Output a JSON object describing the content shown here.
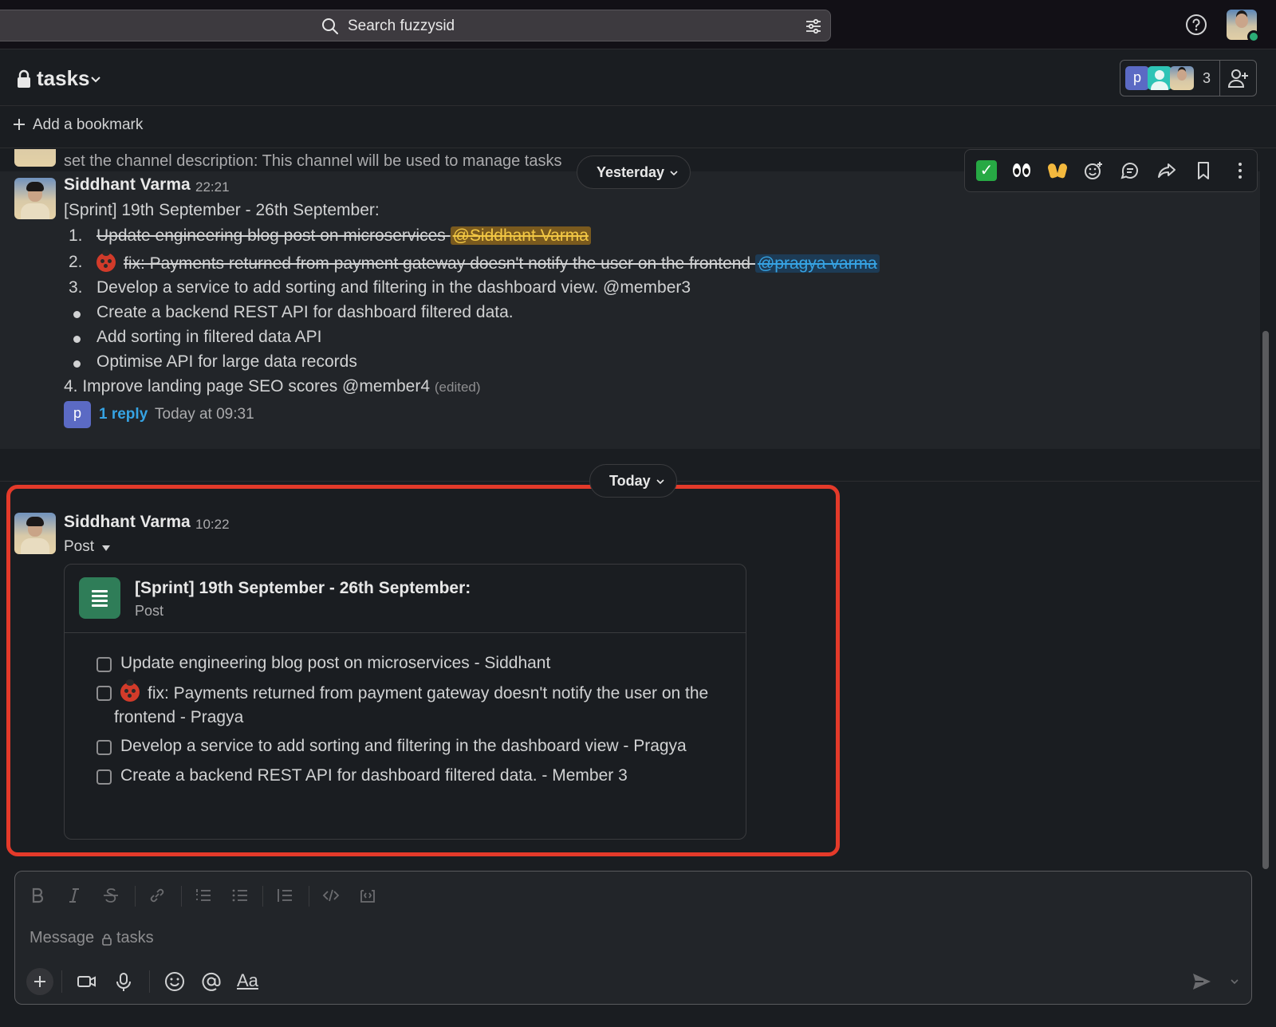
{
  "search": {
    "placeholder": "Search fuzzysid"
  },
  "channel": {
    "name": "tasks",
    "member_count": "3",
    "member_initial": "p"
  },
  "bookmarks": {
    "add_label": "Add a bookmark"
  },
  "previous_message": {
    "text": "set the channel description: This channel will be used to manage tasks"
  },
  "date_dividers": {
    "yesterday": "Yesterday",
    "today": "Today"
  },
  "sprint_message": {
    "author": "Siddhant Varma",
    "time": "22:21",
    "title": "[Sprint] 19th September - 26th September:",
    "items": [
      {
        "num": "1.",
        "text": "Update engineering blog post on microservices ",
        "mention": "@Siddhant Varma"
      },
      {
        "num": "2.",
        "text": "fix: Payments returned from payment gateway doesn't notify the user on the frontend ",
        "mention": "@pragya varma"
      },
      {
        "num": "3.",
        "text": "Develop a service to add sorting and filtering in the dashboard view.   @member3"
      }
    ],
    "bullets": [
      "Create a backend REST API for dashboard filtered data.",
      "Add sorting in filtered data API",
      "Optimise API for large data records"
    ],
    "item4": "4. Improve landing page SEO scores @member4",
    "edited": "(edited)",
    "reply_initial": "p",
    "reply_count": "1 reply",
    "reply_time": "Today at 09:31"
  },
  "post_message": {
    "author": "Siddhant Varma",
    "time": "10:22",
    "type_label": "Post",
    "card_title": "[Sprint] 19th September - 26th September:",
    "card_subtitle": "Post",
    "tasks": [
      "Update engineering blog post on microservices - Siddhant",
      "fix: Payments returned from payment gateway doesn't notify the user on the",
      "frontend - Pragya",
      "Develop a service to add sorting and filtering in the dashboard view - Pragya",
      "Create a backend REST API for dashboard filtered data. - Member 3"
    ]
  },
  "composer": {
    "placeholder": "Message",
    "channel": "tasks",
    "text_format_label": "Aa"
  },
  "colors": {
    "accent_red": "#e43a2a",
    "link_blue": "#36a3e3",
    "mention_gold": "#f2c744",
    "post_green": "#2f7d58"
  }
}
